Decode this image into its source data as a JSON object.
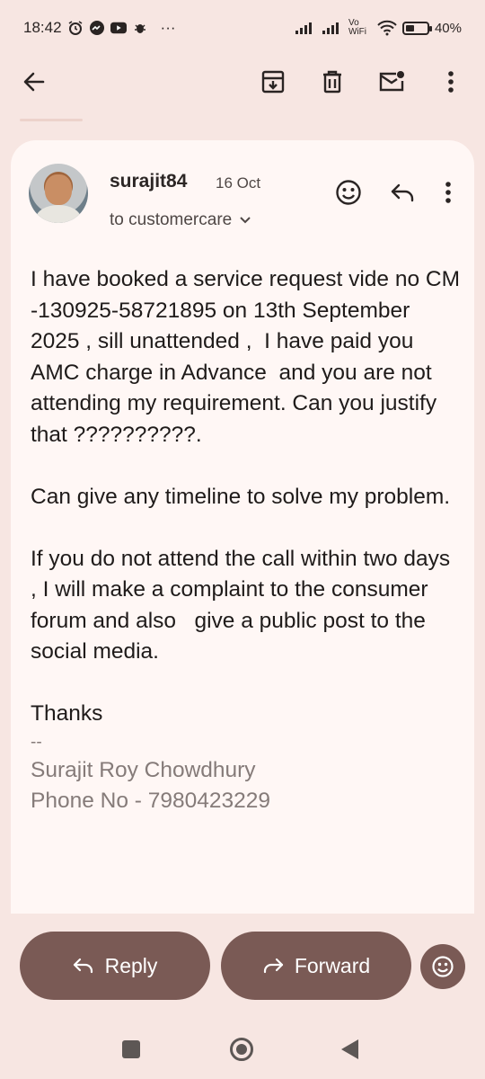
{
  "status_bar": {
    "time": "18:42",
    "more": "···",
    "network_label": "Vo WiFi",
    "battery_percent": "40%",
    "battery_level": 0.4
  },
  "app_bar": {
    "back_icon": "arrow-left-icon",
    "archive_icon": "archive-icon",
    "delete_icon": "trash-icon",
    "mark_unread_icon": "mail-unread-icon",
    "more_icon": "more-vertical-icon"
  },
  "email": {
    "sender": "surajit84",
    "date": "16 Oct",
    "recipient": "to customercare",
    "body": [
      "I have booked a service request vide no CM -130925-58721895 on 13th September 2025 , sill unattended ,  I have paid you AMC charge in Advance  and you are not attending my requirement. Can you justify that ??????????.",
      "Can give any timeline to solve my problem.",
      "If you do not attend the call within two days , I will make a complaint to the consumer forum and also   give a public post to the social media.",
      "Thanks"
    ],
    "signature_separator": "--",
    "signature_name": "Surajit Roy Chowdhury",
    "signature_phone": "Phone No - 7980423229"
  },
  "actions": {
    "reply_label": "Reply",
    "forward_label": "Forward"
  },
  "colors": {
    "background": "#f7e6e2",
    "card": "#fff7f5",
    "accent": "#7a5a55"
  }
}
